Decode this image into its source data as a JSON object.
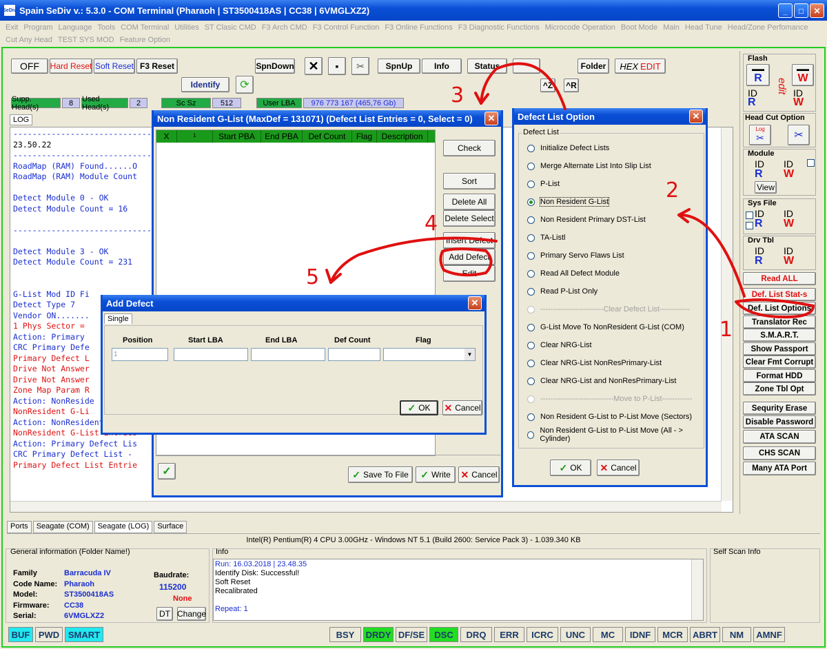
{
  "app": {
    "title": "Spain  SeDiv v.: 5.3.0 - COM Terminal  (Pharaoh  | ST3500418AS | CC38 | 6VMGLXZ2)",
    "logo": "SeDiv"
  },
  "menu": [
    "Exit",
    "Program",
    "Language",
    "Tools",
    "COM Terminal",
    "Utilities",
    "ST Clasic CMD",
    "F3 Arch CMD",
    "F3 Control Function",
    "F3 Online Functions",
    "F3 Diagnostic Functions",
    "Microcode Operation",
    "Boot Mode",
    "Main",
    "Head Tune",
    "Head/Zone Perfomance",
    "Cut Any Head",
    "TEST SYS MOD",
    "Feature Option"
  ],
  "toolbar": {
    "off": "OFF",
    "hard_reset": "Hard Reset",
    "soft_reset": "Soft Reset",
    "f3_reset": "F3 Reset",
    "spndown": "SpnDown",
    "spnup": "SpnUp",
    "info": "Info",
    "status": "Status",
    "folder": "Folder",
    "hex": "HEX",
    "edit": "EDIT",
    "identify": "Identify",
    "ctrl_z": "^Z",
    "ctrl_r": "^R"
  },
  "status_fields": {
    "supp_heads_label": "Supp. Head(s)",
    "supp_heads": "8",
    "used_heads_label": "Used Head(s)",
    "used_heads": "2",
    "sc_sz_label": "Sc Sz",
    "sc_sz": "512",
    "user_lba_label": "User LBA",
    "user_lba": "976 773 167  (465,76 Gb)"
  },
  "log_tab": "LOG",
  "log_lines": [
    {
      "t": "---------------------------------------",
      "c": "blue"
    },
    {
      "t": "23.50.22",
      "c": ""
    },
    {
      "t": "---------------------------------------",
      "c": "blue"
    },
    {
      "t": "RoadMap (RAM) Found......O",
      "c": "blue"
    },
    {
      "t": "RoadMap (RAM) Module Count",
      "c": "blue"
    },
    {
      "t": "",
      "c": ""
    },
    {
      "t": "Detect Module 0 - OK",
      "c": "blue"
    },
    {
      "t": "Detect Module Count = 16",
      "c": "blue"
    },
    {
      "t": "",
      "c": ""
    },
    {
      "t": "---------------------------------------",
      "c": "blue"
    },
    {
      "t": "",
      "c": ""
    },
    {
      "t": "Detect Module 3 - OK",
      "c": "blue"
    },
    {
      "t": "Detect Module Count = 231",
      "c": "blue"
    },
    {
      "t": "",
      "c": ""
    },
    {
      "t": "",
      "c": ""
    },
    {
      "t": "G-List Mod ID Fi",
      "c": "blue"
    },
    {
      "t": "Detect Type 7",
      "c": "blue"
    },
    {
      "t": "Vendor ON.......",
      "c": "blue"
    },
    {
      "t": "1 Phys Sector = ",
      "c": "red"
    },
    {
      "t": "Action: Primary ",
      "c": "blue"
    },
    {
      "t": "CRC Primary Defe",
      "c": "blue"
    },
    {
      "t": "Primary Defect L",
      "c": "red"
    },
    {
      "t": "Drive Not Answer",
      "c": "red"
    },
    {
      "t": "Drive Not Answer",
      "c": "red"
    },
    {
      "t": "Zone Map Param R",
      "c": "red"
    },
    {
      "t": "Action: NonReside",
      "c": "blue"
    },
    {
      "t": "NonResident G-Li",
      "c": "red"
    },
    {
      "t": "Action: NonResident G-List",
      "c": "blue"
    },
    {
      "t": "NonResident G-List Entries",
      "c": "red"
    },
    {
      "t": "Action: Primary Defect Lis",
      "c": "blue"
    },
    {
      "t": "CRC Primary Defect List - ",
      "c": "blue"
    },
    {
      "t": "Primary Defect List Entrie",
      "c": "red"
    }
  ],
  "right_panel": {
    "flash": "Flash",
    "head_cut_option": "Head Cut Option",
    "module": "Module",
    "view": "View",
    "sys_file": "Sys File",
    "drv_tbl": "Drv Tbl",
    "read_all": "Read ALL",
    "def_list_stat": "Def. List Stat-s",
    "def_list_options": "Def. List Options",
    "translator_rec": "Translator Rec",
    "smart": "S.M.A.R.T.",
    "show_passport": "Show Passport",
    "clear_fmt_corrupt": "Clear Fmt Corrupt",
    "format_hdd": "Format HDD",
    "zone_tbl_opt": "Zone Tbl Opt",
    "sequrity_erase": "Sequrity Erase",
    "disable_password": "Disable Password",
    "ata_scan": "ATA SCAN",
    "chs_scan": "CHS SCAN",
    "many_ata_port": "Many ATA Port",
    "id": "ID",
    "r": "R",
    "w": "W",
    "log": "Log",
    "edit_v": "edit"
  },
  "glist_dialog": {
    "title": "Non Resident G-List (MaxDef = 131071) (Defect List Entries = 0, Select = 0)",
    "columns": [
      "X",
      "¹",
      "Start PBA",
      "End PBA",
      "Def Count",
      "Flag",
      "Description"
    ],
    "buttons": {
      "check": "Check",
      "sort": "Sort",
      "delete_all": "Delete All",
      "delete_select": "Delete Select",
      "insert_defect": "Insert Defect",
      "add_defect": "Add Defect",
      "edit": "Edit",
      "save_to_file": "Save To File",
      "write": "Write",
      "cancel": "Cancel"
    }
  },
  "defect_dialog": {
    "title": "Defect List Option",
    "group": "Defect List",
    "options": [
      {
        "label": "Initialize Defect Lists",
        "checked": false,
        "disabled": false
      },
      {
        "label": "Merge Alternate List Into Slip List",
        "checked": false,
        "disabled": false
      },
      {
        "label": "P-List",
        "checked": false,
        "disabled": false
      },
      {
        "label": "Non Resident G-List",
        "checked": true,
        "disabled": false
      },
      {
        "label": "Non Resident Primary DST-List",
        "checked": false,
        "disabled": false
      },
      {
        "label": "TA-Listl",
        "checked": false,
        "disabled": false
      },
      {
        "label": "Primary Servo Flaws List",
        "checked": false,
        "disabled": false
      },
      {
        "label": "Read All Defect Module",
        "checked": false,
        "disabled": false
      },
      {
        "label": "Read P-List Only",
        "checked": false,
        "disabled": false
      },
      {
        "label": "-------------------------Clear Defect List------------",
        "checked": false,
        "disabled": true
      },
      {
        "label": "G-List Move To NonResident G-List (COM)",
        "checked": false,
        "disabled": false
      },
      {
        "label": "Clear NRG-List",
        "checked": false,
        "disabled": false
      },
      {
        "label": "Clear NRG-List NonResPrimary-List",
        "checked": false,
        "disabled": false
      },
      {
        "label": "Clear NRG-List and NonResPrimary-List",
        "checked": false,
        "disabled": false
      },
      {
        "label": "-----------------------------Move to P-List------------",
        "checked": false,
        "disabled": true
      },
      {
        "label": "Non Resident G-List to P-List Move (Sectors)",
        "checked": false,
        "disabled": false
      },
      {
        "label": "Non Resident G-List to P-List Move (All - > Cylinder)",
        "checked": false,
        "disabled": false
      }
    ],
    "ok": "OK",
    "cancel": "Cancel"
  },
  "add_defect_dialog": {
    "title": "Add Defect",
    "tab": "Single",
    "columns": [
      "Position",
      "Start LBA",
      "End LBA",
      "Def Count",
      "Flag"
    ],
    "position_value": "1",
    "ok": "OK",
    "cancel": "Cancel"
  },
  "annotations": [
    "1",
    "2",
    "3",
    "4",
    "5"
  ],
  "bottom_tabs": [
    "Ports",
    "Seagate (COM)",
    "Seagate (LOG)",
    "Surface"
  ],
  "cpu_info": "Intel(R) Pentium(R) 4 CPU 3.00GHz - Windows NT 5.1 (Build 2600: Service Pack 3) - 1.039.340 KB",
  "general_info": {
    "title": "General information (Folder Name!)",
    "family_label": "Family",
    "family": "Barracuda IV",
    "code_name_label": "Code Name:",
    "code_name": "Pharaoh",
    "model_label": "Model:",
    "model": "ST3500418AS",
    "firmware_label": "Firmware:",
    "firmware": "CC38",
    "serial_label": "Serial:",
    "serial": "6VMGLXZ2",
    "baudrate_label": "Baudrate:",
    "baudrate": "115200",
    "none": "None",
    "dt": "DT",
    "change": "Change"
  },
  "info": {
    "title": "Info",
    "lines": [
      "Run: 16.03.2018 | 23.48.35",
      "Identify Disk: Successful!",
      "Soft Reset",
      "Recalibrated",
      "",
      "Repeat: 1"
    ]
  },
  "self_scan": "Self Scan Info",
  "indicators_left": [
    {
      "label": "BUF",
      "on": "cy"
    },
    {
      "label": "PWD",
      "on": ""
    },
    {
      "label": "SMART",
      "on": "cy"
    }
  ],
  "indicators_right": [
    {
      "label": "BSY",
      "on": ""
    },
    {
      "label": "DRDY",
      "on": "g"
    },
    {
      "label": "DF/SE",
      "on": ""
    },
    {
      "label": "DSC",
      "on": "g"
    },
    {
      "label": "DRQ",
      "on": ""
    },
    {
      "label": "ERR",
      "on": ""
    },
    {
      "label": "ICRC",
      "on": ""
    },
    {
      "label": "UNC",
      "on": ""
    },
    {
      "label": "MC",
      "on": ""
    },
    {
      "label": "IDNF",
      "on": ""
    },
    {
      "label": "MCR",
      "on": ""
    },
    {
      "label": "ABRT",
      "on": ""
    },
    {
      "label": "NM",
      "on": ""
    },
    {
      "label": "AMNF",
      "on": ""
    }
  ]
}
